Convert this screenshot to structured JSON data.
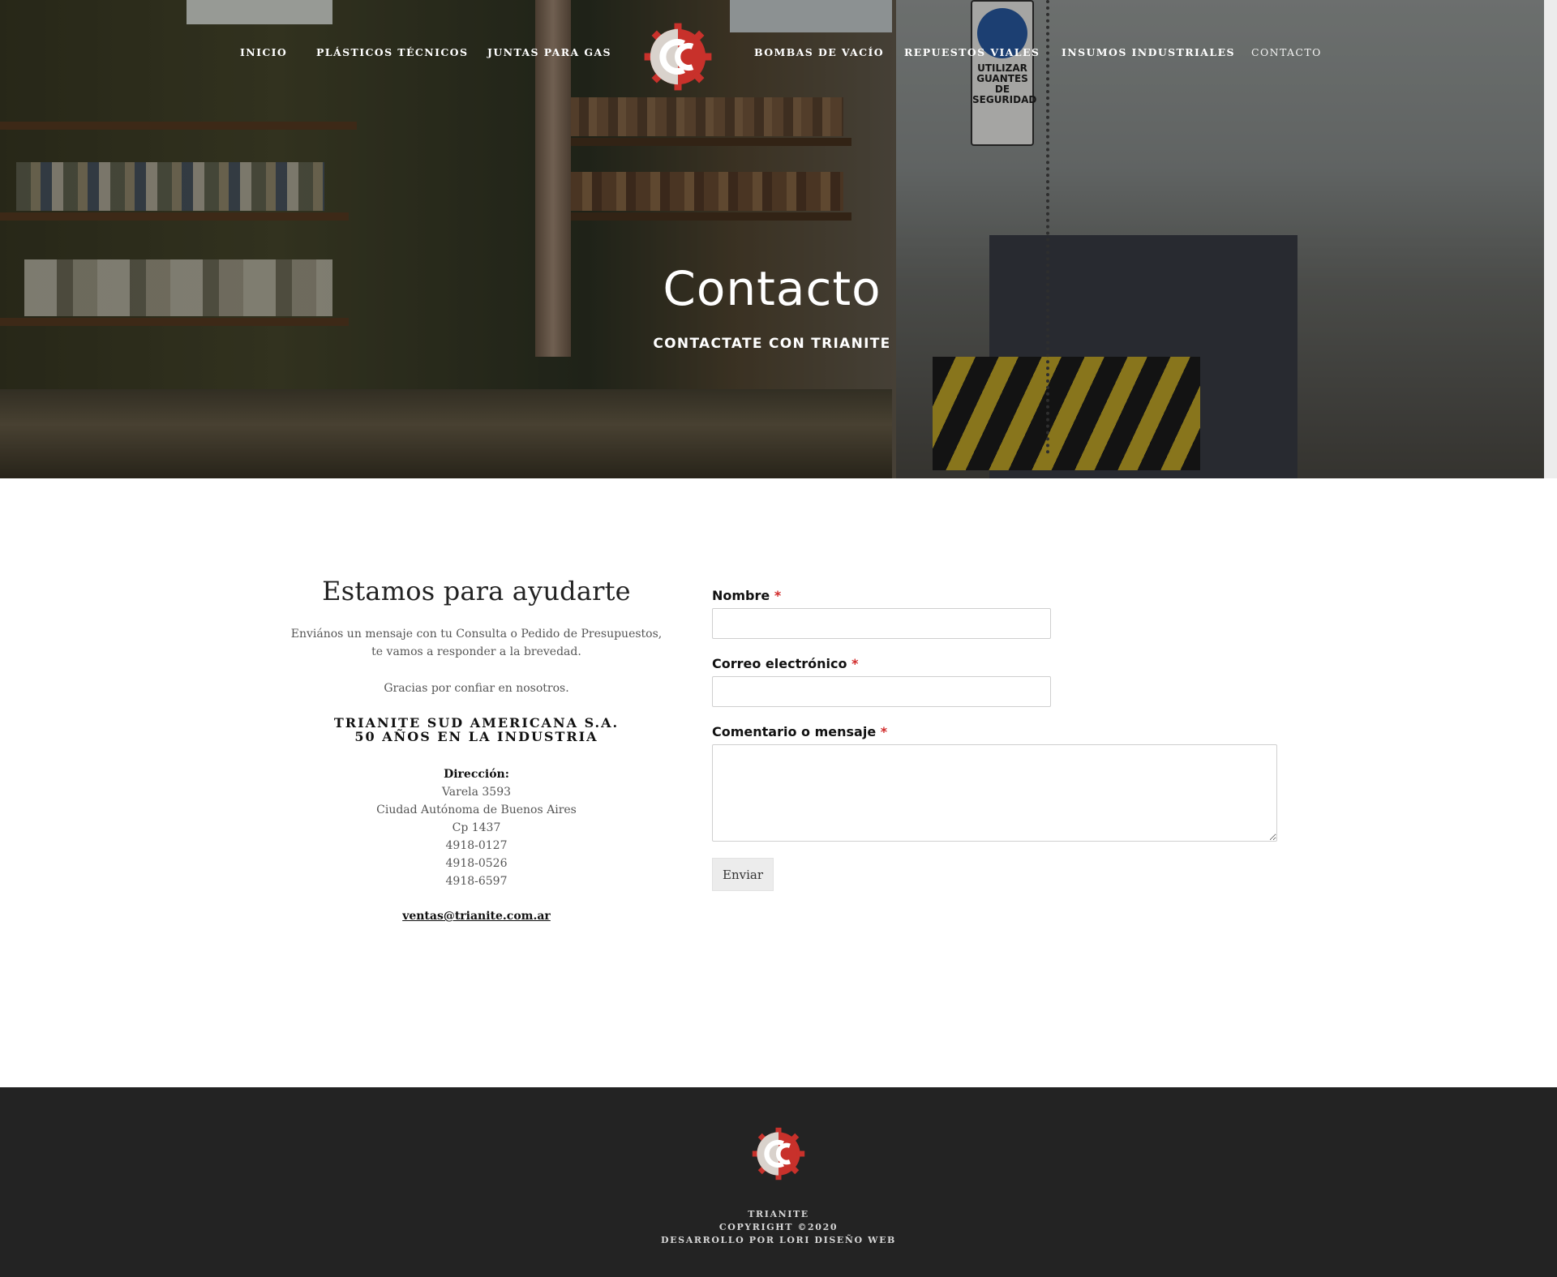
{
  "nav": {
    "items": [
      {
        "label": "INICIO"
      },
      {
        "label": "PLÁSTICOS TÉCNICOS"
      },
      {
        "label": "JUNTAS PARA GAS"
      },
      {
        "label": "BOMBAS DE VACÍO"
      },
      {
        "label": "REPUESTOS VIALES"
      },
      {
        "label": "INSUMOS INDUSTRIALES"
      },
      {
        "label": "CONTACTO"
      }
    ],
    "active": "CONTACTO"
  },
  "hero": {
    "title": "Contacto",
    "subtitle": "CONTACTATE CON TRIANITE",
    "sign_text": [
      "UTILIZAR",
      "GUANTES DE",
      "SEGURIDAD"
    ]
  },
  "info": {
    "heading": "Estamos para ayudarte",
    "paragraph_1": "Enviános un mensaje con tu Consulta o Pedido de Presupuestos, te vamos a responder a la brevedad.",
    "paragraph_2": "Gracias por confiar en nosotros.",
    "company_name": "TRIANITE SUD AMERICANA S.A.",
    "company_tagline": "50 AÑOS EN LA INDUSTRIA",
    "address_label": "Dirección:",
    "address_lines": [
      "Varela 3593",
      "Ciudad Autónoma de Buenos Aires",
      "Cp 1437",
      "4918-0127",
      "4918-0526",
      "4918-6597"
    ],
    "email": "ventas@trianite.com.ar"
  },
  "form": {
    "name_label": "Nombre",
    "email_label": "Correo electrónico",
    "message_label": "Comentario o mensaje",
    "required_mark": "*",
    "name_value": "",
    "email_value": "",
    "message_value": "",
    "submit_label": "Enviar"
  },
  "footer": {
    "lines": [
      "TRIANITE",
      "COPYRIGHT ©2020",
      "DESARROLLO POR LORI DISEÑO WEB"
    ]
  },
  "colors": {
    "brand_red": "#c8312b",
    "footer_bg": "#232323",
    "required": "#d12b2b"
  },
  "icons": {
    "logo": "gear-cc-logo-icon",
    "footer_logo": "gear-cc-logo-icon"
  }
}
